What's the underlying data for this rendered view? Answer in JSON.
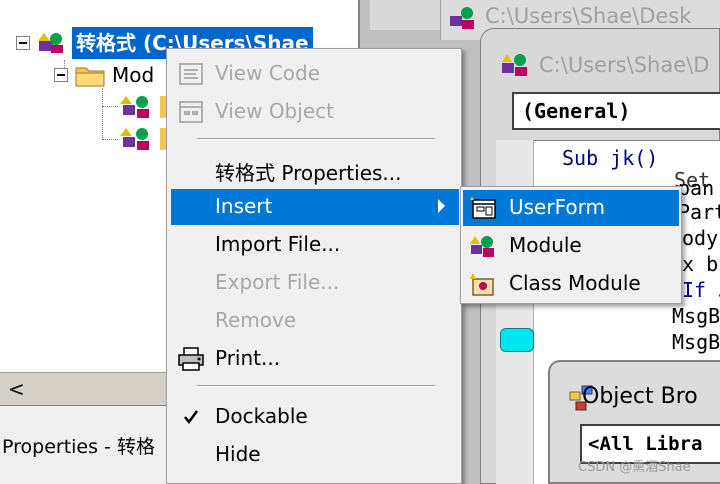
{
  "explorer": {
    "root_label": "转格式 (C:\\Users\\Shae",
    "modules_folder_label": "Mod",
    "scroll_left_glyph": "<"
  },
  "properties_panel": {
    "title": "Properties - 转格"
  },
  "code_windows": {
    "back_title": "C:\\Users\\Shae\\Desk",
    "front_title": "C:\\Users\\Shae\\D",
    "object_combo": "(General)",
    "code_lines": [
      "Sub jk()",
      "Set",
      "pan",
      "Part",
      "ody",
      "x b",
      "If J",
      "MsgB",
      "MsgB"
    ]
  },
  "object_browser": {
    "title": "Object Bro",
    "library_combo": "<All Libra"
  },
  "context_menu": {
    "view_code": "View Code",
    "view_object": "View Object",
    "properties": "转格式 Properties...",
    "insert": "Insert",
    "import_file": "Import File...",
    "export_file": "Export File...",
    "remove": "Remove",
    "print": "Print...",
    "dockable": "Dockable",
    "hide": "Hide"
  },
  "insert_submenu": {
    "userform": "UserForm",
    "module": "Module",
    "class_module": "Class Module"
  },
  "watermark": "CSDN @熏酒Shae",
  "colors": {
    "selection": "#0078d7",
    "tree_selection": "#0066cc",
    "breakpoint": "#00e5ee"
  }
}
